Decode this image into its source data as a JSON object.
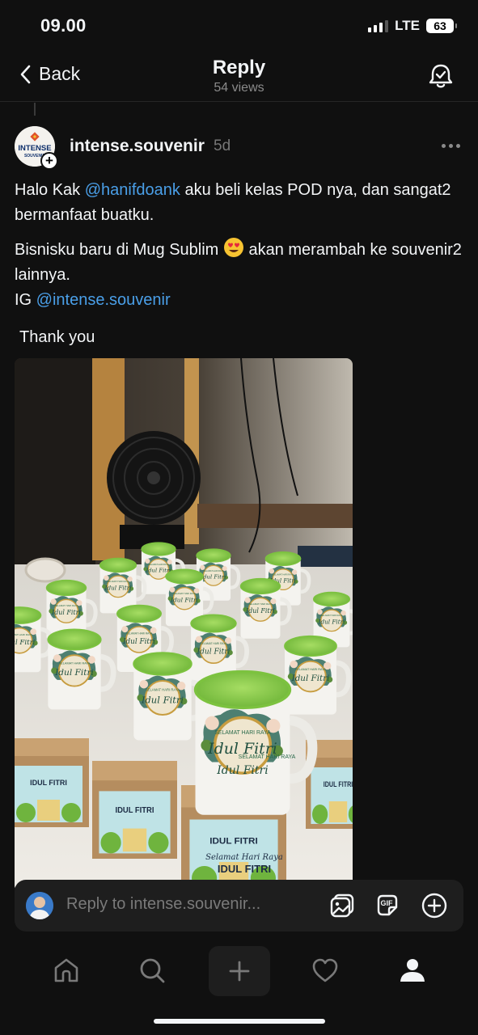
{
  "status_bar": {
    "time": "09.00",
    "network": "LTE",
    "battery": "63"
  },
  "header": {
    "back_label": "Back",
    "title": "Reply",
    "views": "54 views"
  },
  "post": {
    "avatar_text": "INTENSE SOUVENIR",
    "username": "intense.souvenir",
    "time": "5d",
    "line1_prefix": "Halo Kak ",
    "line1_mention": "@hanifdoank",
    "line1_suffix": " aku beli kelas POD nya, dan sangat2 bermanfaat buatku.",
    "line2_prefix": "Bisnisku baru di Mug Sublim ",
    "line2_suffix": " akan merambah ke souvenir2 lainnya.",
    "line3_prefix": "IG ",
    "line3_mention": "@intense.souvenir",
    "thanks": "Thank you"
  },
  "photo": {
    "mug_text_top": "SELAMAT HARI RAYA",
    "mug_text_main": "Idul Fitri",
    "box_text_small": "Selamat Hari Raya",
    "box_text_main": "IDUL FITRI"
  },
  "reply": {
    "placeholder": "Reply to intense.souvenir..."
  },
  "colors": {
    "background": "#101010",
    "mention": "#4a9fe8",
    "muted": "#777777",
    "mug_green": "#8fd14f"
  },
  "icons": {
    "back": "chevron-left-icon",
    "bell": "bell-check-icon",
    "more": "more-horizontal-icon",
    "image": "image-icon",
    "gif": "gif-icon",
    "add": "plus-circle-icon",
    "nav": [
      "home-icon",
      "search-icon",
      "compose-plus-icon",
      "heart-icon",
      "profile-icon"
    ]
  }
}
